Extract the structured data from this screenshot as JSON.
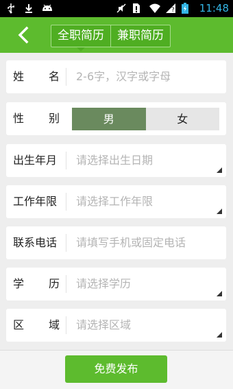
{
  "status_bar": {
    "time": "11:48",
    "icons": [
      "usb-icon",
      "download-icon",
      "android-icon",
      "mute-icon",
      "sim-icon",
      "wifi-icon",
      "signal-unknown-icon",
      "battery-charging-icon"
    ],
    "time_color": "#33b5e5"
  },
  "header": {
    "back_icon": "chevron-left-icon",
    "tabs": [
      {
        "label": "全职简历",
        "active": true
      },
      {
        "label": "兼职简历",
        "active": false
      }
    ],
    "accent": "#5dbb2e"
  },
  "form": {
    "name": {
      "label_a": "姓",
      "label_b": "名",
      "placeholder": "2-6字，汉字或字母"
    },
    "gender": {
      "label_a": "性",
      "label_b": "别",
      "options": [
        "男",
        "女"
      ],
      "selected": "男"
    },
    "birth": {
      "label": "出生年月",
      "placeholder": "请选择出生日期"
    },
    "experience": {
      "label": "工作年限",
      "placeholder": "请选择工作年限"
    },
    "phone": {
      "label": "联系电话",
      "placeholder": "请填写手机或固定电话"
    },
    "education": {
      "label_a": "学",
      "label_b": "历",
      "placeholder": "请选择学历"
    },
    "region": {
      "label_a": "区",
      "label_b": "域",
      "placeholder": "请选择区域"
    }
  },
  "footer": {
    "publish_label": "免费发布"
  }
}
